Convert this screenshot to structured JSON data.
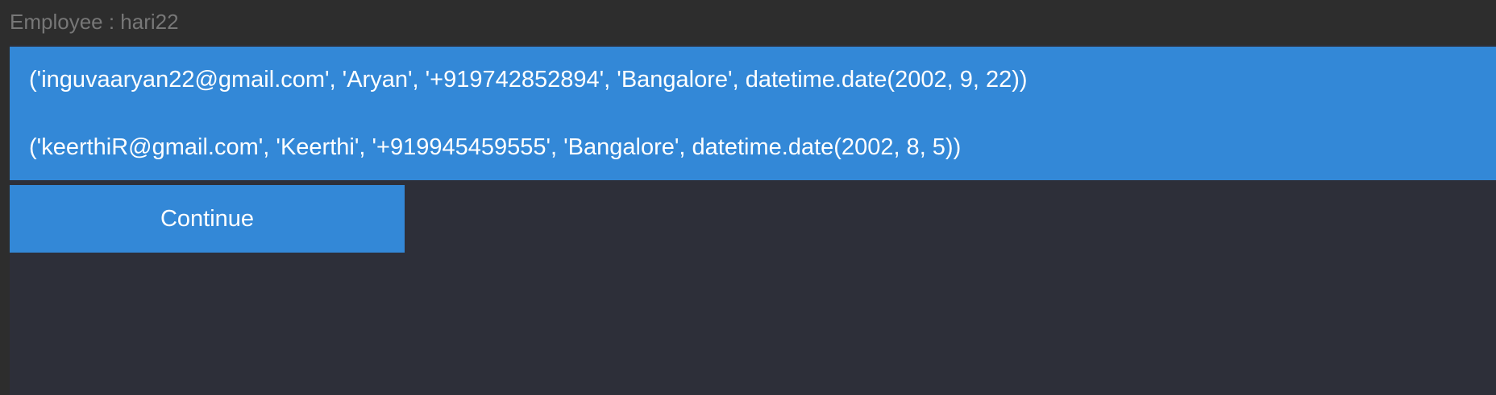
{
  "header": {
    "title": "Employee : hari22"
  },
  "records": [
    "('inguvaaryan22@gmail.com', 'Aryan', '+919742852894', 'Bangalore', datetime.date(2002, 9, 22))",
    "('keerthiR@gmail.com', 'Keerthi', '+919945459555', 'Bangalore', datetime.date(2002, 8, 5))"
  ],
  "actions": {
    "continue_label": "Continue"
  },
  "colors": {
    "accent": "#3388d7",
    "header_background": "#2d2d2d",
    "content_background": "#2d2f39",
    "header_text": "#777777",
    "text": "#ffffff"
  }
}
